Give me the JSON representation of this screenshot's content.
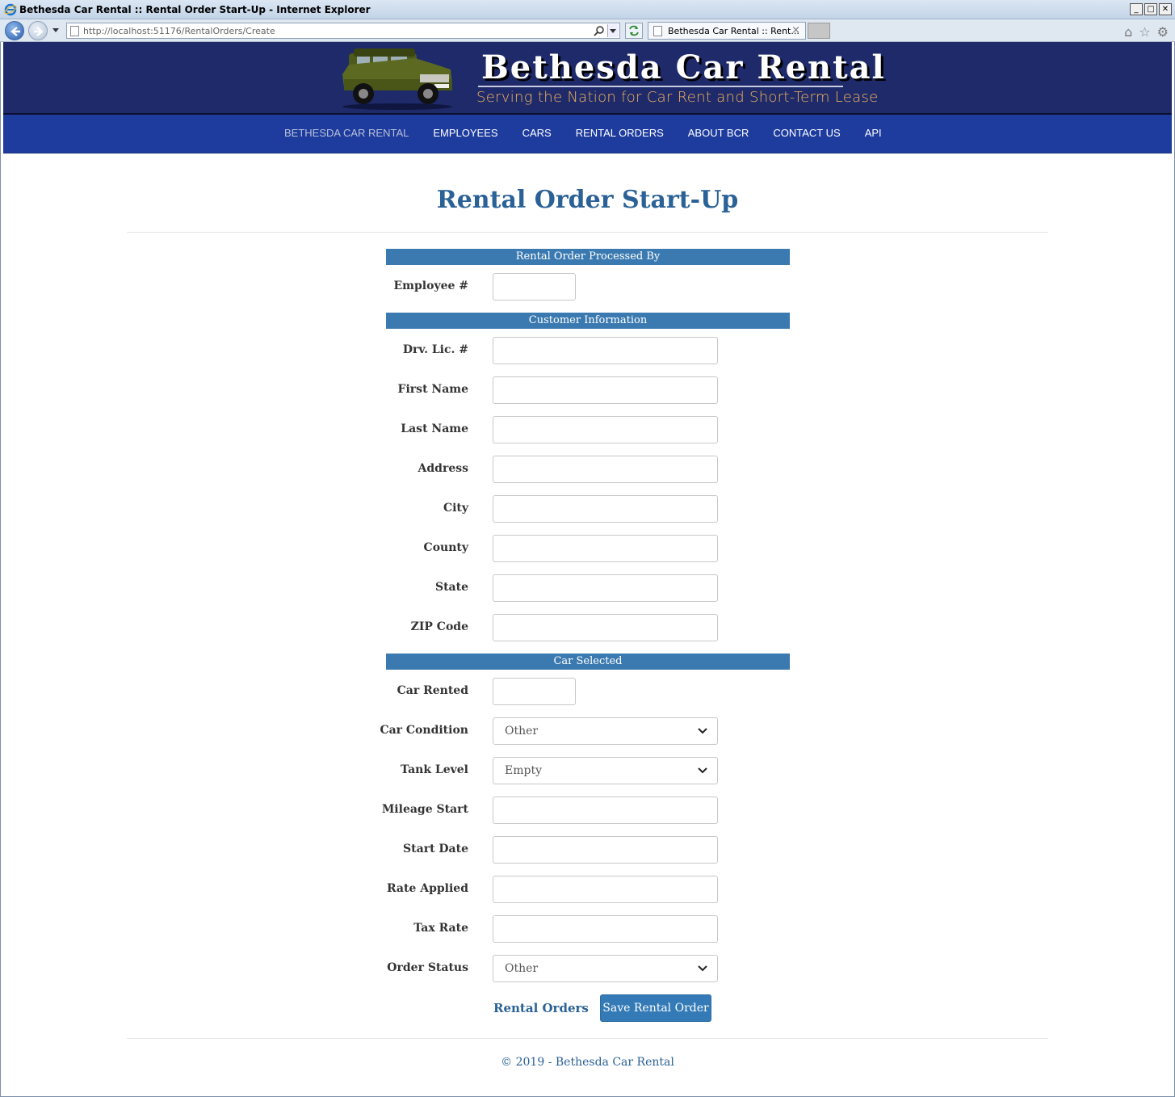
{
  "window": {
    "title": "Bethesda Car Rental :: Rental Order Start-Up - Internet Explorer",
    "controls": [
      "_",
      "□",
      "✕"
    ]
  },
  "browser": {
    "url": "http://localhost:51176/RentalOrders/Create",
    "tab_title": "Bethesda Car Rental :: Rent...",
    "tab_close": "×",
    "icons": [
      "back-icon",
      "forward-icon",
      "search-icon",
      "refresh-icon",
      "home-icon",
      "favorites-star-icon",
      "settings-gear-icon"
    ]
  },
  "site": {
    "brand": "Bethesda Car Rental",
    "slogan": "Serving the Nation for Car Rent and Short-Term Lease",
    "nav": [
      "BETHESDA CAR RENTAL",
      "EMPLOYEES",
      "CARS",
      "RENTAL ORDERS",
      "ABOUT BCR",
      "CONTACT US",
      "API"
    ]
  },
  "page": {
    "title": "Rental Order Start-Up",
    "sections": {
      "processed_by": "Rental Order Processed By",
      "customer": "Customer Information",
      "car": "Car Selected"
    },
    "labels": {
      "employee": "Employee #",
      "drv_lic": "Drv. Lic. #",
      "first_name": "First Name",
      "last_name": "Last Name",
      "address": "Address",
      "city": "City",
      "county": "County",
      "state": "State",
      "zip": "ZIP Code",
      "car_rented": "Car Rented",
      "car_condition": "Car Condition",
      "tank_level": "Tank Level",
      "mileage_start": "Mileage Start",
      "start_date": "Start Date",
      "rate_applied": "Rate Applied",
      "tax_rate": "Tax Rate",
      "order_status": "Order Status"
    },
    "values": {
      "car_condition": "Other",
      "tank_level": "Empty",
      "order_status": "Other"
    },
    "back_link": "Rental Orders",
    "save_button": "Save Rental Order",
    "footer": "© 2019 - Bethesda Car Rental"
  },
  "colors": {
    "header_bg": "#1e2a6a",
    "nav_bg": "#1e3c9e",
    "accent": "#2a6196",
    "section_bar": "#3b7ab1",
    "button": "#337ab7",
    "slogan": "#f2b35c"
  }
}
